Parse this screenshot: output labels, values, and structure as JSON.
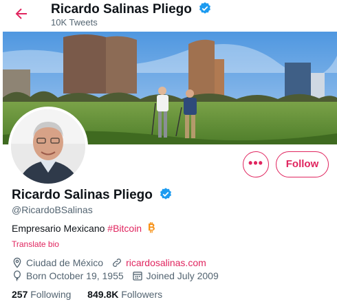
{
  "header": {
    "name": "Ricardo Salinas Pliego",
    "tweet_count": "10K Tweets",
    "back_icon": "arrow-left-icon",
    "verified_icon": "verified-badge-icon"
  },
  "profile": {
    "display_name": "Ricardo Salinas Pliego",
    "handle": "@RicardoBSalinas",
    "bio_text": "Empresario Mexicano ",
    "bio_hashtag": "#Bitcoin",
    "translate_label": "Translate bio",
    "location": "Ciudad de México",
    "website": "ricardosalinas.com",
    "birthday": "Born October 19, 1955",
    "joined": "Joined July 2009"
  },
  "actions": {
    "more_label": "•••",
    "follow_label": "Follow"
  },
  "stats": {
    "following_count": "257",
    "following_label": "Following",
    "followers_count": "849.8K",
    "followers_label": "Followers"
  },
  "colors": {
    "accent": "#e0245e",
    "verified": "#1d9bf0",
    "secondary_text": "#536471",
    "bitcoin": "#f7931a"
  }
}
